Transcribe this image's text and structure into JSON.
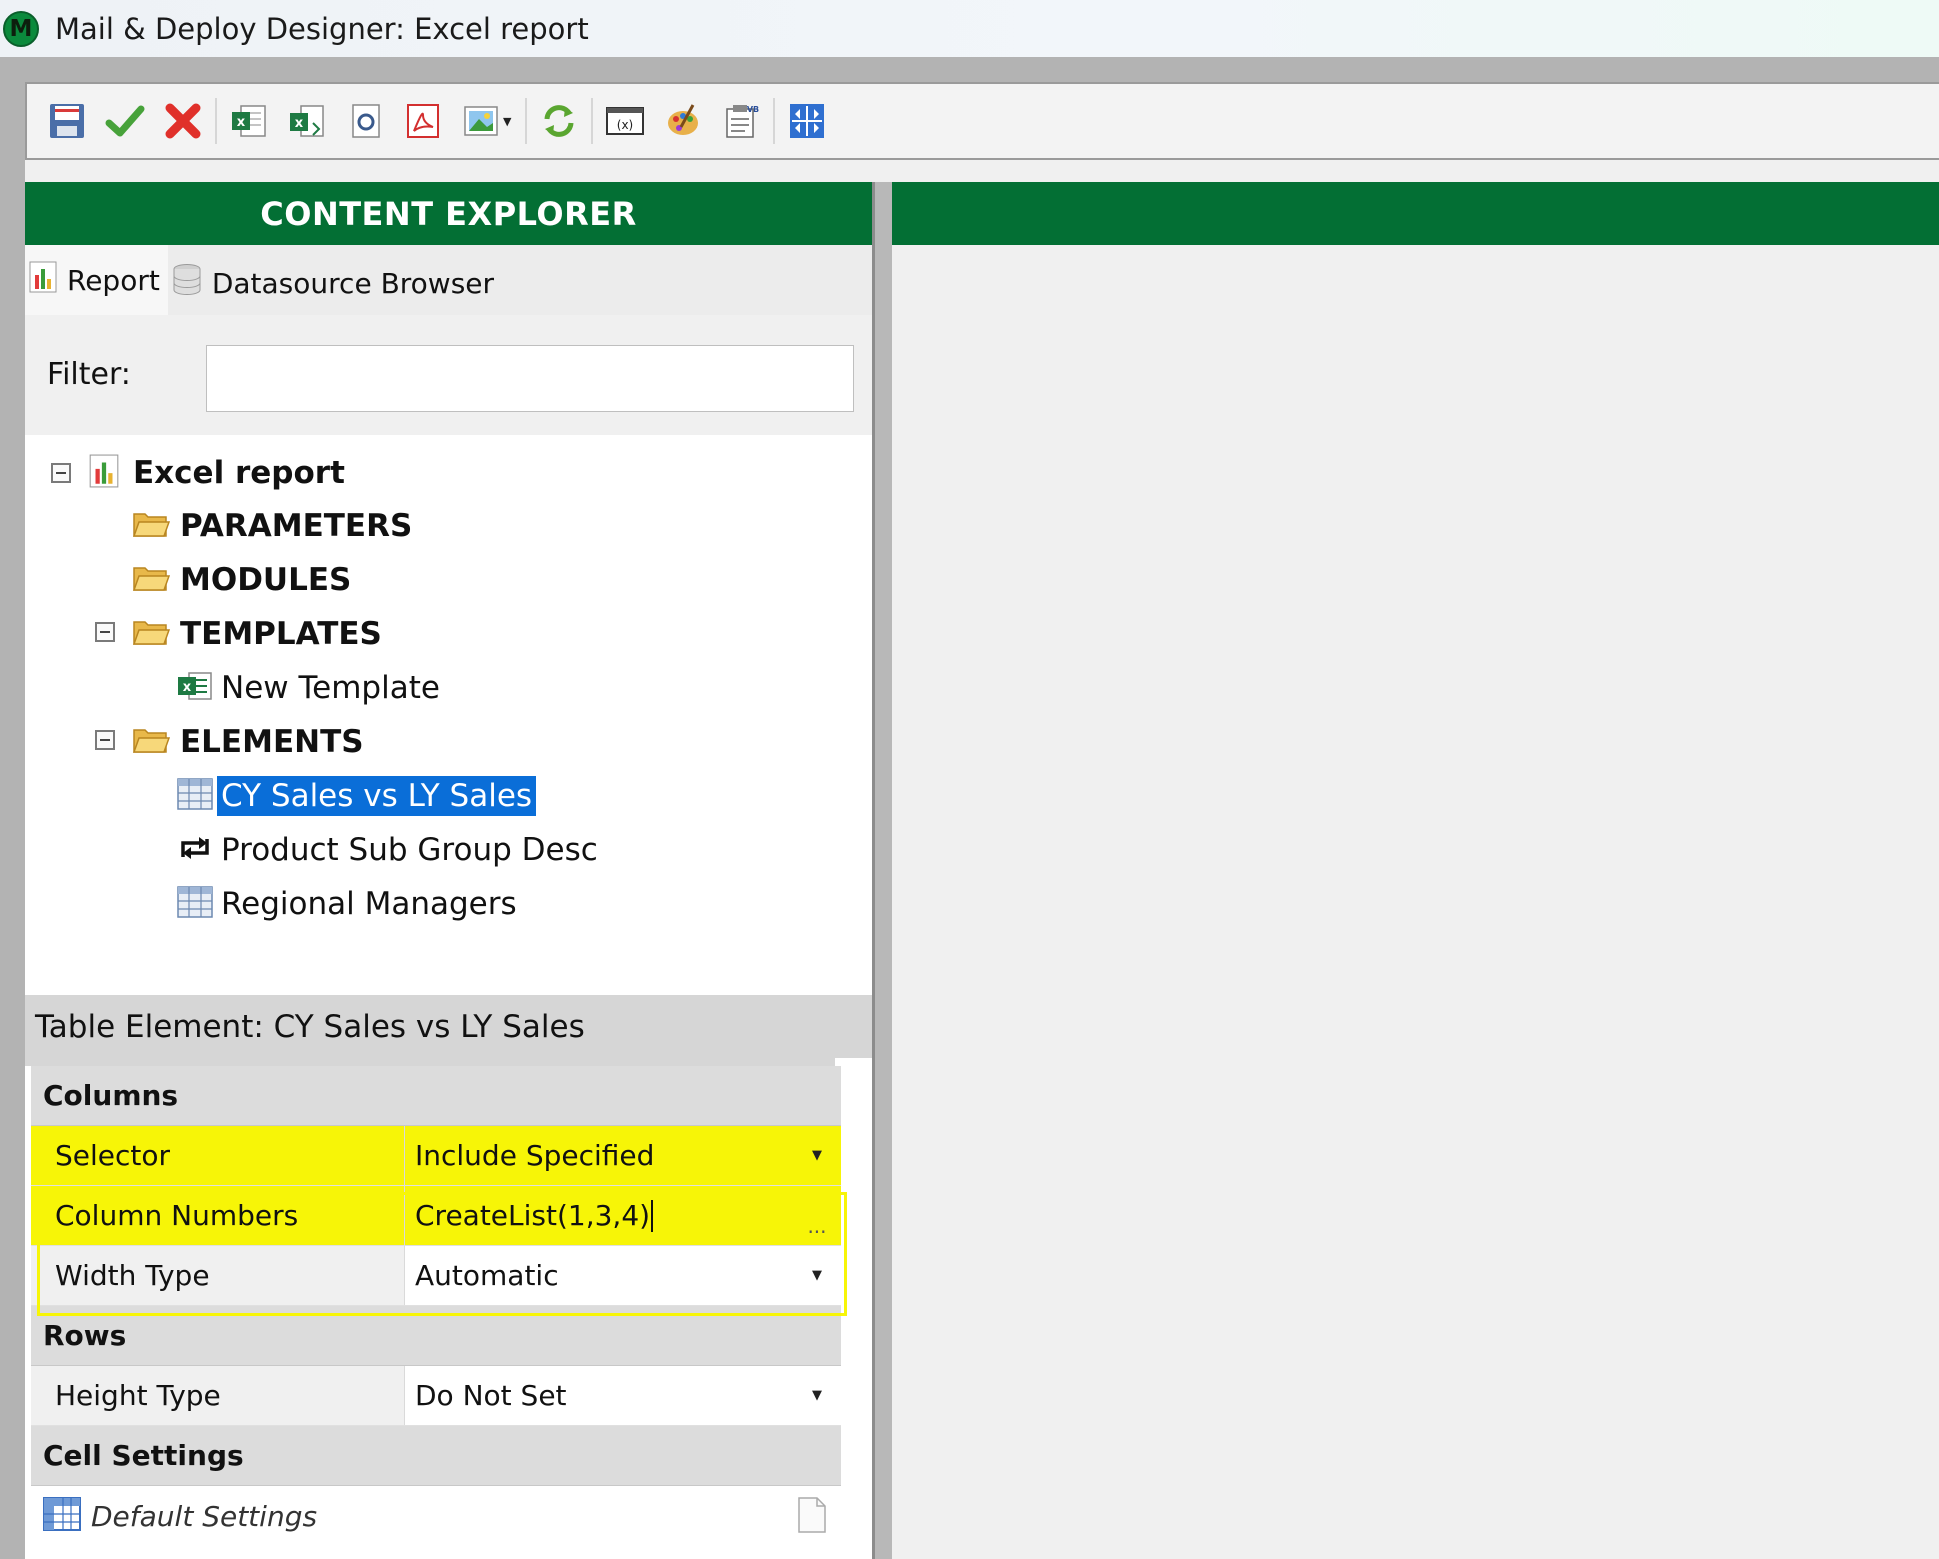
{
  "window": {
    "title": "Mail & Deploy Designer: Excel report",
    "logo_letter": "M",
    "brand_color": "#036f34"
  },
  "toolbar": {
    "buttons": [
      "save-icon",
      "checkmark-icon",
      "delete-icon",
      "excel-export-icon",
      "excel-template-icon",
      "preview-icon",
      "pdf-icon",
      "image-icon",
      "refresh-icon",
      "variable-icon",
      "palette-icon",
      "vb-script-icon",
      "layout-icon"
    ]
  },
  "explorer": {
    "header": "CONTENT EXPLORER",
    "tabs": [
      {
        "label": "Report",
        "icon": "report-icon",
        "active": true
      },
      {
        "label": "Datasource Browser",
        "icon": "database-icon",
        "active": false
      }
    ],
    "filter": {
      "label": "Filter:",
      "value": ""
    },
    "tree": {
      "root": "Excel report",
      "parameters": "PARAMETERS",
      "modules": "MODULES",
      "templates": "TEMPLATES",
      "new_template": "New Template",
      "elements": "ELEMENTS",
      "element_items": [
        "CY Sales vs LY Sales",
        "Product Sub Group Desc",
        "Regional Managers"
      ],
      "selected": "CY Sales vs LY Sales"
    }
  },
  "properties": {
    "title": "Table Element: CY Sales vs LY Sales",
    "categories": {
      "columns": "Columns",
      "rows": "Rows",
      "cell_settings": "Cell Settings"
    },
    "selector": {
      "name": "Selector",
      "value": "Include Specified"
    },
    "column_numbers": {
      "name": "Column Numbers",
      "value": "CreateList(1,3,4)"
    },
    "width_type": {
      "name": "Width Type",
      "value": "Automatic"
    },
    "height_type": {
      "name": "Height Type",
      "value": "Do Not Set"
    },
    "default_settings": "Default Settings",
    "ellipsis": "...",
    "highlight_color": "#f7f507"
  }
}
